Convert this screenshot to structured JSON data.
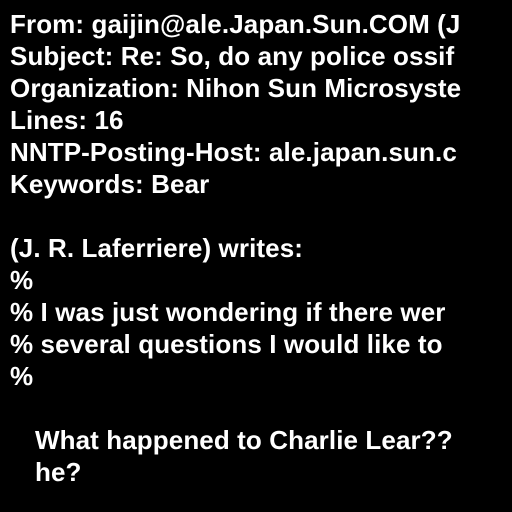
{
  "header": {
    "from": "From: gaijin@ale.Japan.Sun.COM (J",
    "subject": "Subject: Re: So, do any police ossif",
    "organization": "Organization: Nihon Sun Microsyste",
    "lines": "Lines: 16",
    "nntp_host": "NNTP-Posting-Host: ale.japan.sun.c",
    "keywords": "Keywords: Bear"
  },
  "body": {
    "attribution": "(J. R. Laferriere) writes:",
    "quote": [
      "%",
      "% I was just wondering if there wer",
      "% several questions I would like to",
      "%"
    ],
    "reply": [
      "What happened to Charlie Lear??",
      "he?"
    ]
  },
  "colors": {
    "background": "#000000",
    "text": "#ffffff"
  }
}
